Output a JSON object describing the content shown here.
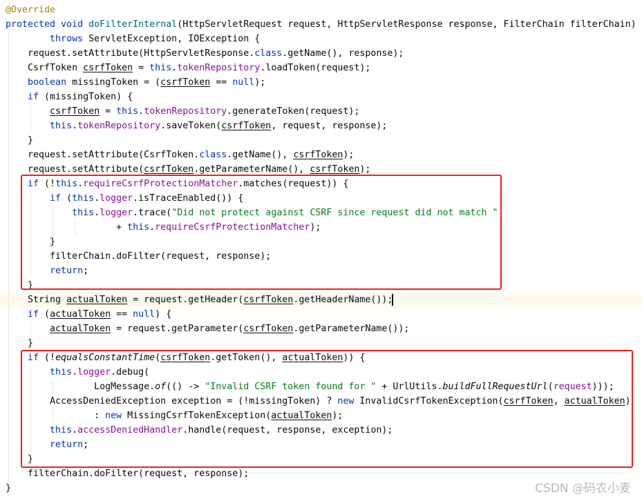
{
  "editor": {
    "language": "java",
    "colors": {
      "keyword": "#0033b3",
      "field": "#871094",
      "string": "#067d17",
      "method_decl": "#00627a",
      "annotation": "#9e880d",
      "highlight_box": "#f0201c",
      "current_line": "#fcfaed"
    },
    "current_line": 21,
    "highlighted_blocks": [
      [
        13,
        20
      ],
      [
        25,
        32
      ]
    ],
    "lines": [
      [
        [
          "a",
          "@Override"
        ]
      ],
      [
        [
          "k",
          "protected"
        ],
        [
          "p",
          " "
        ],
        [
          "k",
          "void"
        ],
        [
          "p",
          " "
        ],
        [
          "m",
          "doFilterInternal"
        ],
        [
          "p",
          "(HttpServletRequest request, HttpServletResponse response, FilterChain filterChain)"
        ]
      ],
      [
        [
          "p",
          "        "
        ],
        [
          "k",
          "throws"
        ],
        [
          "p",
          " ServletException, IOException {"
        ]
      ],
      [
        [
          "p",
          "    request.setAttribute(HttpServletResponse."
        ],
        [
          "k",
          "class"
        ],
        [
          "p",
          ".getName(), response);"
        ]
      ],
      [
        [
          "p",
          "    CsrfToken "
        ],
        [
          "u",
          "csrfToken"
        ],
        [
          "p",
          " = "
        ],
        [
          "k",
          "this"
        ],
        [
          "p",
          "."
        ],
        [
          "f",
          "tokenRepository"
        ],
        [
          "p",
          ".loadToken(request);"
        ]
      ],
      [
        [
          "p",
          "    "
        ],
        [
          "k",
          "boolean"
        ],
        [
          "p",
          " missingToken = ("
        ],
        [
          "u",
          "csrfToken"
        ],
        [
          "p",
          " == "
        ],
        [
          "k",
          "null"
        ],
        [
          "p",
          ");"
        ]
      ],
      [
        [
          "p",
          "    "
        ],
        [
          "k",
          "if"
        ],
        [
          "p",
          " (missingToken) {"
        ]
      ],
      [
        [
          "p",
          "        "
        ],
        [
          "u",
          "csrfToken"
        ],
        [
          "p",
          " = "
        ],
        [
          "k",
          "this"
        ],
        [
          "p",
          "."
        ],
        [
          "f",
          "tokenRepository"
        ],
        [
          "p",
          ".generateToken(request);"
        ]
      ],
      [
        [
          "p",
          "        "
        ],
        [
          "k",
          "this"
        ],
        [
          "p",
          "."
        ],
        [
          "f",
          "tokenRepository"
        ],
        [
          "p",
          ".saveToken("
        ],
        [
          "u",
          "csrfToken"
        ],
        [
          "p",
          ", request, response);"
        ]
      ],
      [
        [
          "p",
          "    }"
        ]
      ],
      [
        [
          "p",
          "    request.setAttribute(CsrfToken."
        ],
        [
          "k",
          "class"
        ],
        [
          "p",
          ".getName(), "
        ],
        [
          "u",
          "csrfToken"
        ],
        [
          "p",
          ");"
        ]
      ],
      [
        [
          "p",
          "    request.setAttribute("
        ],
        [
          "u",
          "csrfToken"
        ],
        [
          "p",
          ".getParameterName(), "
        ],
        [
          "u",
          "csrfToken"
        ],
        [
          "p",
          ");"
        ]
      ],
      [
        [
          "p",
          "    "
        ],
        [
          "k",
          "if"
        ],
        [
          "p",
          " (!"
        ],
        [
          "k",
          "this"
        ],
        [
          "p",
          "."
        ],
        [
          "f",
          "requireCsrfProtectionMatcher"
        ],
        [
          "p",
          ".matches(request)) {"
        ]
      ],
      [
        [
          "p",
          "        "
        ],
        [
          "k",
          "if"
        ],
        [
          "p",
          " ("
        ],
        [
          "k",
          "this"
        ],
        [
          "p",
          "."
        ],
        [
          "f",
          "logger"
        ],
        [
          "p",
          ".isTraceEnabled()) {"
        ]
      ],
      [
        [
          "p",
          "            "
        ],
        [
          "k",
          "this"
        ],
        [
          "p",
          "."
        ],
        [
          "f",
          "logger"
        ],
        [
          "p",
          ".trace("
        ],
        [
          "s",
          "\"Did not protect against CSRF since request did not match \""
        ]
      ],
      [
        [
          "p",
          "                    + "
        ],
        [
          "k",
          "this"
        ],
        [
          "p",
          "."
        ],
        [
          "f",
          "requireCsrfProtectionMatcher"
        ],
        [
          "p",
          ");"
        ]
      ],
      [
        [
          "p",
          "        }"
        ]
      ],
      [
        [
          "p",
          "        filterChain.doFilter(request, response);"
        ]
      ],
      [
        [
          "p",
          "        "
        ],
        [
          "k",
          "return"
        ],
        [
          "p",
          ";"
        ]
      ],
      [
        [
          "p",
          "    }"
        ]
      ],
      [
        [
          "p",
          "    String "
        ],
        [
          "u",
          "actualToken"
        ],
        [
          "p",
          " = request.getHeader("
        ],
        [
          "u",
          "csrfToken"
        ],
        [
          "p",
          ".getHeaderName());"
        ]
      ],
      [
        [
          "p",
          "    "
        ],
        [
          "k",
          "if"
        ],
        [
          "p",
          " ("
        ],
        [
          "u",
          "actualToken"
        ],
        [
          "p",
          " == "
        ],
        [
          "k",
          "null"
        ],
        [
          "p",
          ") {"
        ]
      ],
      [
        [
          "p",
          "        "
        ],
        [
          "u",
          "actualToken"
        ],
        [
          "p",
          " = request.getParameter("
        ],
        [
          "u",
          "csrfToken"
        ],
        [
          "p",
          ".getParameterName());"
        ]
      ],
      [
        [
          "p",
          "    }"
        ]
      ],
      [
        [
          "p",
          "    "
        ],
        [
          "k",
          "if"
        ],
        [
          "p",
          " (!"
        ],
        [
          "i",
          "equalsConstantTime"
        ],
        [
          "p",
          "("
        ],
        [
          "u",
          "csrfToken"
        ],
        [
          "p",
          ".getToken(), "
        ],
        [
          "u",
          "actualToken"
        ],
        [
          "p",
          ")) {"
        ]
      ],
      [
        [
          "p",
          "        "
        ],
        [
          "k",
          "this"
        ],
        [
          "p",
          "."
        ],
        [
          "f",
          "logger"
        ],
        [
          "p",
          ".debug("
        ]
      ],
      [
        [
          "p",
          "                LogMessage."
        ],
        [
          "i",
          "of"
        ],
        [
          "p",
          "(() -> "
        ],
        [
          "s",
          "\"Invalid CSRF token found for \""
        ],
        [
          "p",
          " + UrlUtils."
        ],
        [
          "i",
          "buildFullRequestUrl"
        ],
        [
          "p",
          "("
        ],
        [
          "f",
          "request"
        ],
        [
          "p",
          ")));"
        ]
      ],
      [
        [
          "p",
          "        AccessDeniedException exception = (!missingToken) ? "
        ],
        [
          "k",
          "new"
        ],
        [
          "p",
          " InvalidCsrfTokenException("
        ],
        [
          "u",
          "csrfToken"
        ],
        [
          "p",
          ", "
        ],
        [
          "u",
          "actualToken"
        ],
        [
          "p",
          ")"
        ]
      ],
      [
        [
          "p",
          "                : "
        ],
        [
          "k",
          "new"
        ],
        [
          "p",
          " MissingCsrfTokenException("
        ],
        [
          "u",
          "actualToken"
        ],
        [
          "p",
          ");"
        ]
      ],
      [
        [
          "p",
          "        "
        ],
        [
          "k",
          "this"
        ],
        [
          "p",
          "."
        ],
        [
          "f",
          "accessDeniedHandler"
        ],
        [
          "p",
          ".handle(request, response, exception);"
        ]
      ],
      [
        [
          "p",
          "        "
        ],
        [
          "k",
          "return"
        ],
        [
          "p",
          ";"
        ]
      ],
      [
        [
          "p",
          "    }"
        ]
      ],
      [
        [
          "p",
          "    filterChain.doFilter(request, response);"
        ]
      ],
      [
        [
          "p",
          "}"
        ]
      ]
    ]
  },
  "watermark": "CSDN @码农小麦"
}
